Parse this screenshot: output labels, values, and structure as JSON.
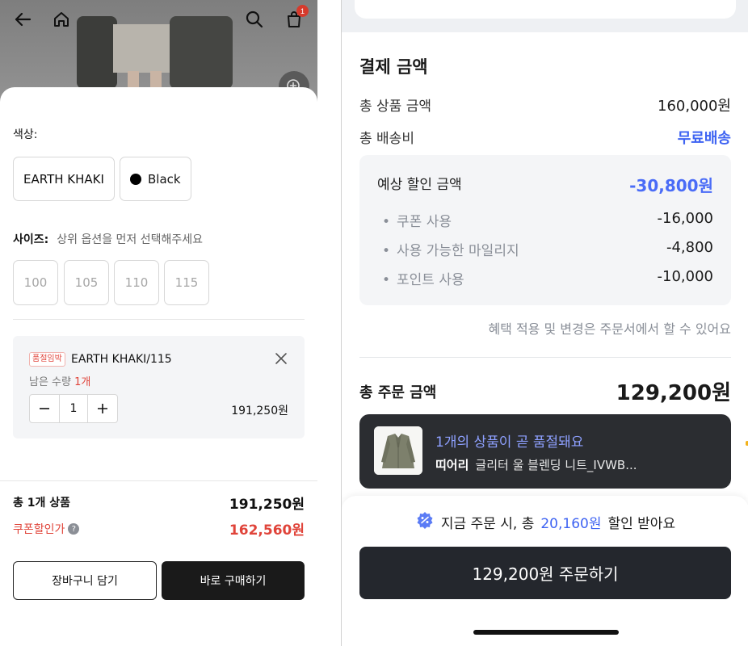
{
  "left": {
    "header": {
      "cart_badge_count": "1"
    },
    "options": {
      "color_label": "색상:",
      "colors": [
        {
          "label": "EARTH KHAKI"
        },
        {
          "label": "Black",
          "swatch": "#000000"
        }
      ],
      "size_label": "사이즈:",
      "size_hint": "상위 옵션을 먼저 선택해주세요",
      "sizes": [
        "100",
        "105",
        "110",
        "115"
      ]
    },
    "selected_item": {
      "tag": "품절임박",
      "name": "EARTH KHAKI/115",
      "remaining_prefix": "남은 수량",
      "remaining_count": "1개",
      "quantity": "1",
      "price": "191,250원"
    },
    "summary": {
      "total_label": "총 1개 상품",
      "total_value": "191,250원",
      "coupon_label": "쿠폰할인가",
      "coupon_help": "?",
      "coupon_value": "162,560원"
    },
    "actions": {
      "cart_button": "장바구니 담기",
      "buy_button": "바로 구매하기"
    }
  },
  "right": {
    "payment": {
      "title": "결제 금액",
      "product_total_label": "총 상품 금액",
      "product_total_value": "160,000원",
      "shipping_label": "총 배송비",
      "shipping_value": "무료배송",
      "discount": {
        "title": "예상 할인 금액",
        "total": "-30,800원",
        "items": [
          {
            "label": "쿠폰 사용",
            "value": "-16,000"
          },
          {
            "label": "사용 가능한 마일리지",
            "value": "-4,800"
          },
          {
            "label": "포인트 사용",
            "value": "-10,000"
          }
        ]
      },
      "note": "혜택 적용 및 변경은 주문서에서 할 수 있어요",
      "order_total_label": "총 주문 금액",
      "order_total_value": "129,200원"
    },
    "toast": {
      "title": "1개의 상품이 곧 품절돼요",
      "brand": "띠어리",
      "product": "글리터 울 블렌딩 니트_IVWB..."
    },
    "bottom": {
      "promo_prefix": "지금 주문 시, 총",
      "promo_amount": "20,160원",
      "promo_suffix": "할인 받아요",
      "order_button": "129,200원 주문하기"
    }
  },
  "colors": {
    "accent_blue": "#3e63f2",
    "discount_blue": "#4a6cf7",
    "alert_red": "#e0443a",
    "dark_button": "#1a1a1a"
  }
}
